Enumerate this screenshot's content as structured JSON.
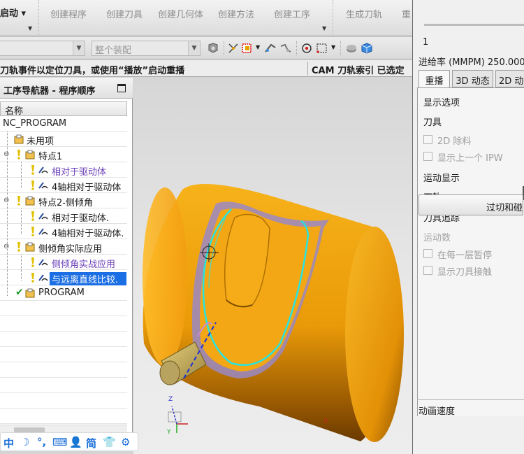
{
  "ribbon": {
    "start_menu": "启动",
    "items": [
      "创建程序",
      "创建刀具",
      "创建几何体",
      "创建方法",
      "创建工序",
      "生成刀轨",
      "重"
    ]
  },
  "toolbar2": {
    "combo1": "",
    "combo2": "整个装配"
  },
  "status": {
    "message": "刀轨事件以定位刀具，或使用“播放”启动重播",
    "cam": "CAM 刀轨索引 已选定"
  },
  "navigator": {
    "title": "工序导航器 - 程序顺序",
    "column_header": "名称",
    "rows": [
      {
        "label": "NC_PROGRAM"
      },
      {
        "label": "未用项"
      },
      {
        "label": "特点1"
      },
      {
        "label": "相对于驱动体"
      },
      {
        "label": "4轴相对于驱动体"
      },
      {
        "label": "特点2-侧倾角"
      },
      {
        "label": "相对于驱动体."
      },
      {
        "label": "4轴相对于驱动体."
      },
      {
        "label": "侧倾角实际应用"
      },
      {
        "label": "侧倾角实战应用"
      },
      {
        "label": "与远离直线比较."
      },
      {
        "label": "PROGRAM"
      }
    ]
  },
  "ime": {
    "items": [
      "中",
      "☽",
      "°,",
      "⌨",
      "👤",
      "简",
      "👕",
      "⚙"
    ]
  },
  "right_panel": {
    "frame_value": "1",
    "feed_rate": "进给率 (MMPM) 250.000",
    "tabs": [
      "重播",
      "3D 动态",
      "2D 动"
    ],
    "display_options": "显示选项",
    "tool": "刀具",
    "cb_2d_remove": "2D 除料",
    "cb_show_prev_ipw": "显示上一个 IPW",
    "motion_display": "运动显示",
    "tool_path": "刀轨",
    "tool_trace": "刀具追踪",
    "motion_count": "运动数",
    "cb_pause_each_layer": "在每一层暂停",
    "cb_show_tool_contact": "显示刀具接触",
    "button_overcut": "过切和碰",
    "animation_speed": "动画速度"
  },
  "colors": {
    "part_orange": "#f5a30f",
    "toolpath_cyan": "#27e3e0",
    "selection_blue": "#1b6ee3",
    "purple_text": "#6b3fb8"
  },
  "viewport": {
    "axis_labels": {
      "x": "X",
      "y": "Y",
      "z": "Z"
    }
  }
}
